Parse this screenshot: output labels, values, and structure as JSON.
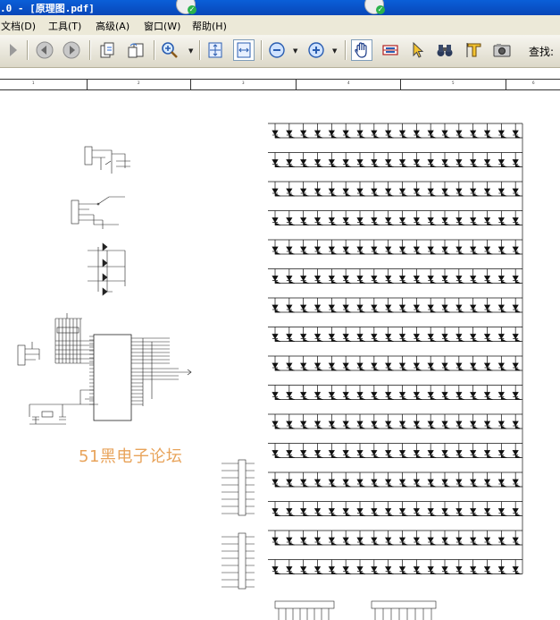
{
  "window": {
    "title": ".0 - [原理图.pdf]"
  },
  "menu": {
    "items": [
      "文档(D)",
      "工具(T)",
      "高级(A)",
      "窗口(W)",
      "帮助(H)"
    ]
  },
  "toolbar": {
    "find_label": "查找:",
    "buttons": [
      "play-icon",
      "back-icon",
      "forward-icon",
      "copy-pages-icon",
      "paste-pages-icon",
      "zoom-in-icon",
      "fit-page-icon",
      "fit-width-icon",
      "zoom-out-icon",
      "zoom-plus-icon",
      "hand-tool-icon",
      "select-text-icon",
      "pointer-icon",
      "find-binoculars-icon",
      "text-tool-icon",
      "snapshot-camera-icon"
    ]
  },
  "document": {
    "watermark": "51黑电子论坛",
    "ruler_labels": [
      "1",
      "2",
      "3",
      "4",
      "5",
      "6",
      "7"
    ]
  }
}
